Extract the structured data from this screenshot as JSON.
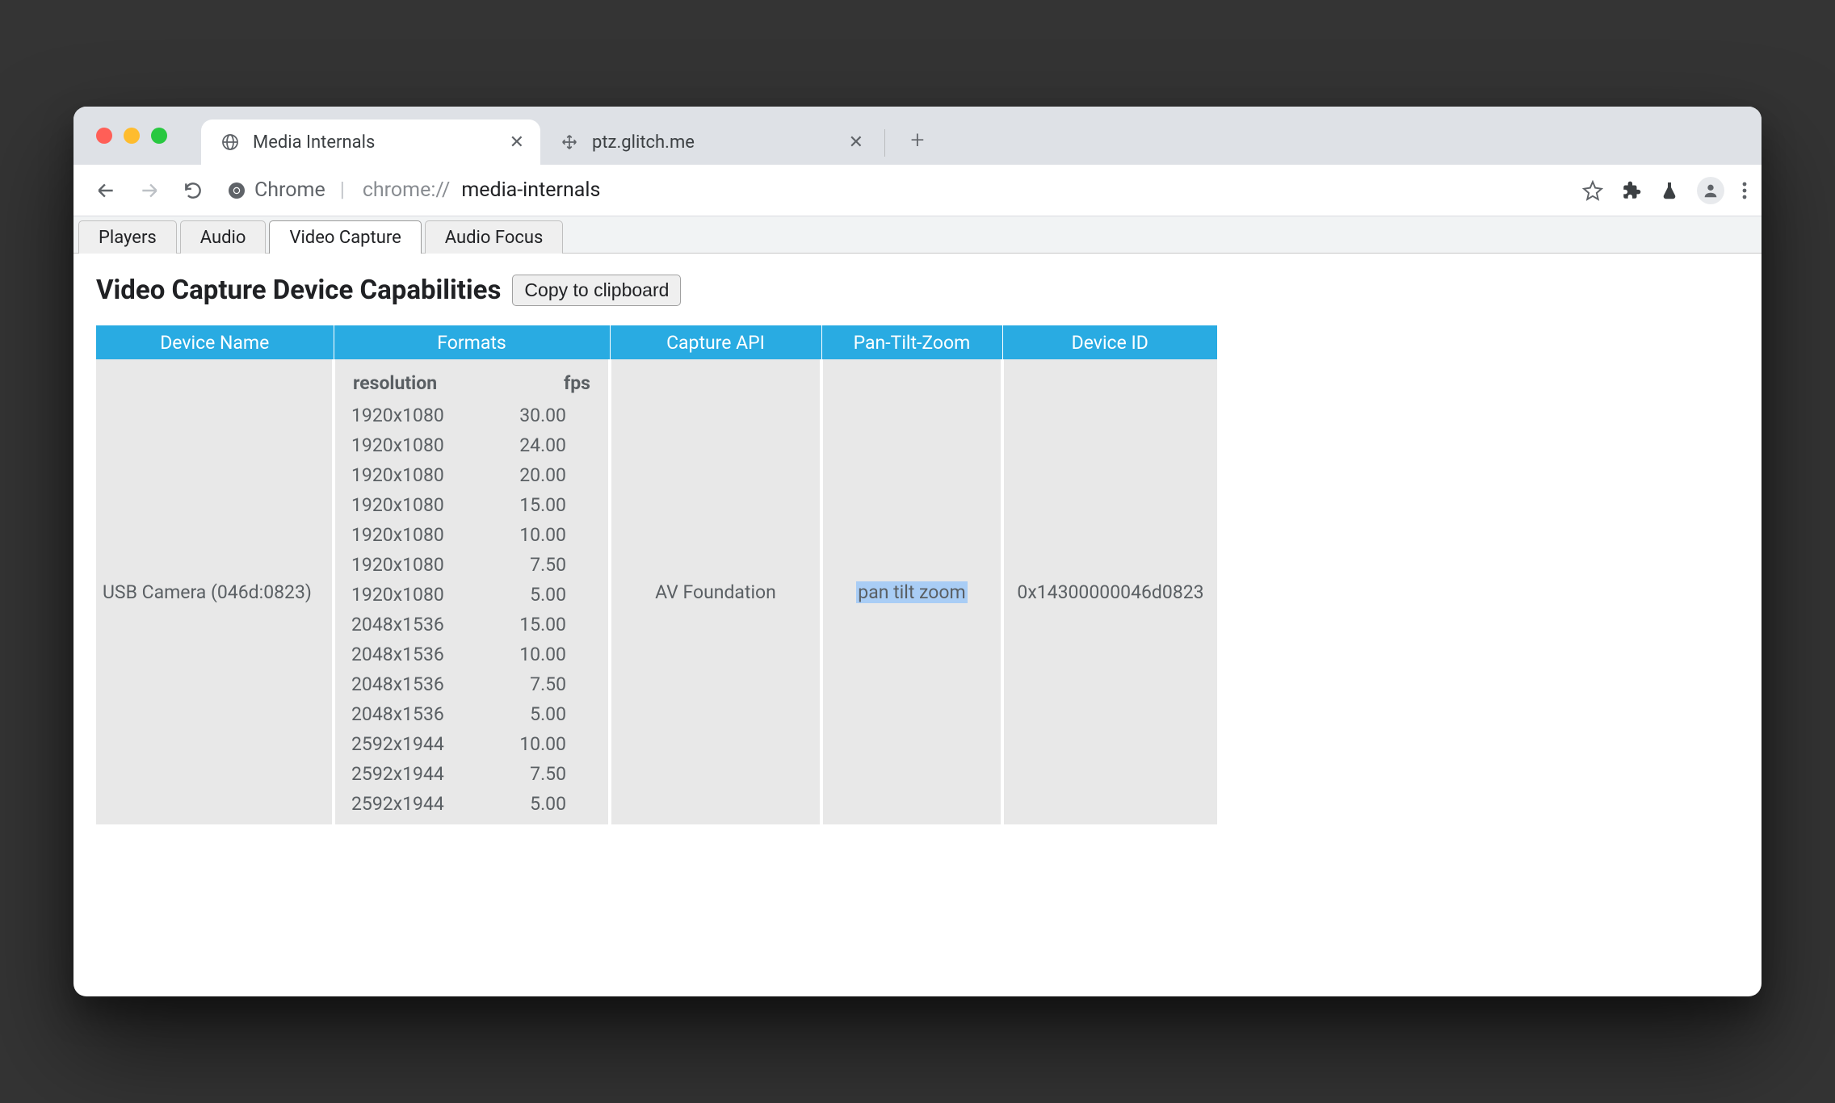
{
  "browser": {
    "tabs": [
      {
        "title": "Media Internals",
        "active": true
      },
      {
        "title": "ptz.glitch.me",
        "active": false
      }
    ],
    "omnibox": {
      "origin_label": "Chrome",
      "url_scheme": "chrome://",
      "url_path": "media-internals"
    }
  },
  "internal_tabs": {
    "items": [
      "Players",
      "Audio",
      "Video Capture",
      "Audio Focus"
    ],
    "active_index": 2
  },
  "page": {
    "heading": "Video Capture Device Capabilities",
    "copy_button": "Copy to clipboard",
    "columns": {
      "name": "Device Name",
      "formats": "Formats",
      "api": "Capture API",
      "ptz": "Pan-Tilt-Zoom",
      "id": "Device ID"
    },
    "device": {
      "name": "USB Camera (046d:0823)",
      "capture_api": "AV Foundation",
      "ptz": "pan tilt zoom",
      "device_id": "0x14300000046d0823",
      "formats_header": {
        "res": "resolution",
        "fps": "fps"
      },
      "formats": [
        {
          "res": "1920x1080",
          "fps": "30.00"
        },
        {
          "res": "1920x1080",
          "fps": "24.00"
        },
        {
          "res": "1920x1080",
          "fps": "20.00"
        },
        {
          "res": "1920x1080",
          "fps": "15.00"
        },
        {
          "res": "1920x1080",
          "fps": "10.00"
        },
        {
          "res": "1920x1080",
          "fps": "7.50"
        },
        {
          "res": "1920x1080",
          "fps": "5.00"
        },
        {
          "res": "2048x1536",
          "fps": "15.00"
        },
        {
          "res": "2048x1536",
          "fps": "10.00"
        },
        {
          "res": "2048x1536",
          "fps": "7.50"
        },
        {
          "res": "2048x1536",
          "fps": "5.00"
        },
        {
          "res": "2592x1944",
          "fps": "10.00"
        },
        {
          "res": "2592x1944",
          "fps": "7.50"
        },
        {
          "res": "2592x1944",
          "fps": "5.00"
        }
      ]
    }
  }
}
